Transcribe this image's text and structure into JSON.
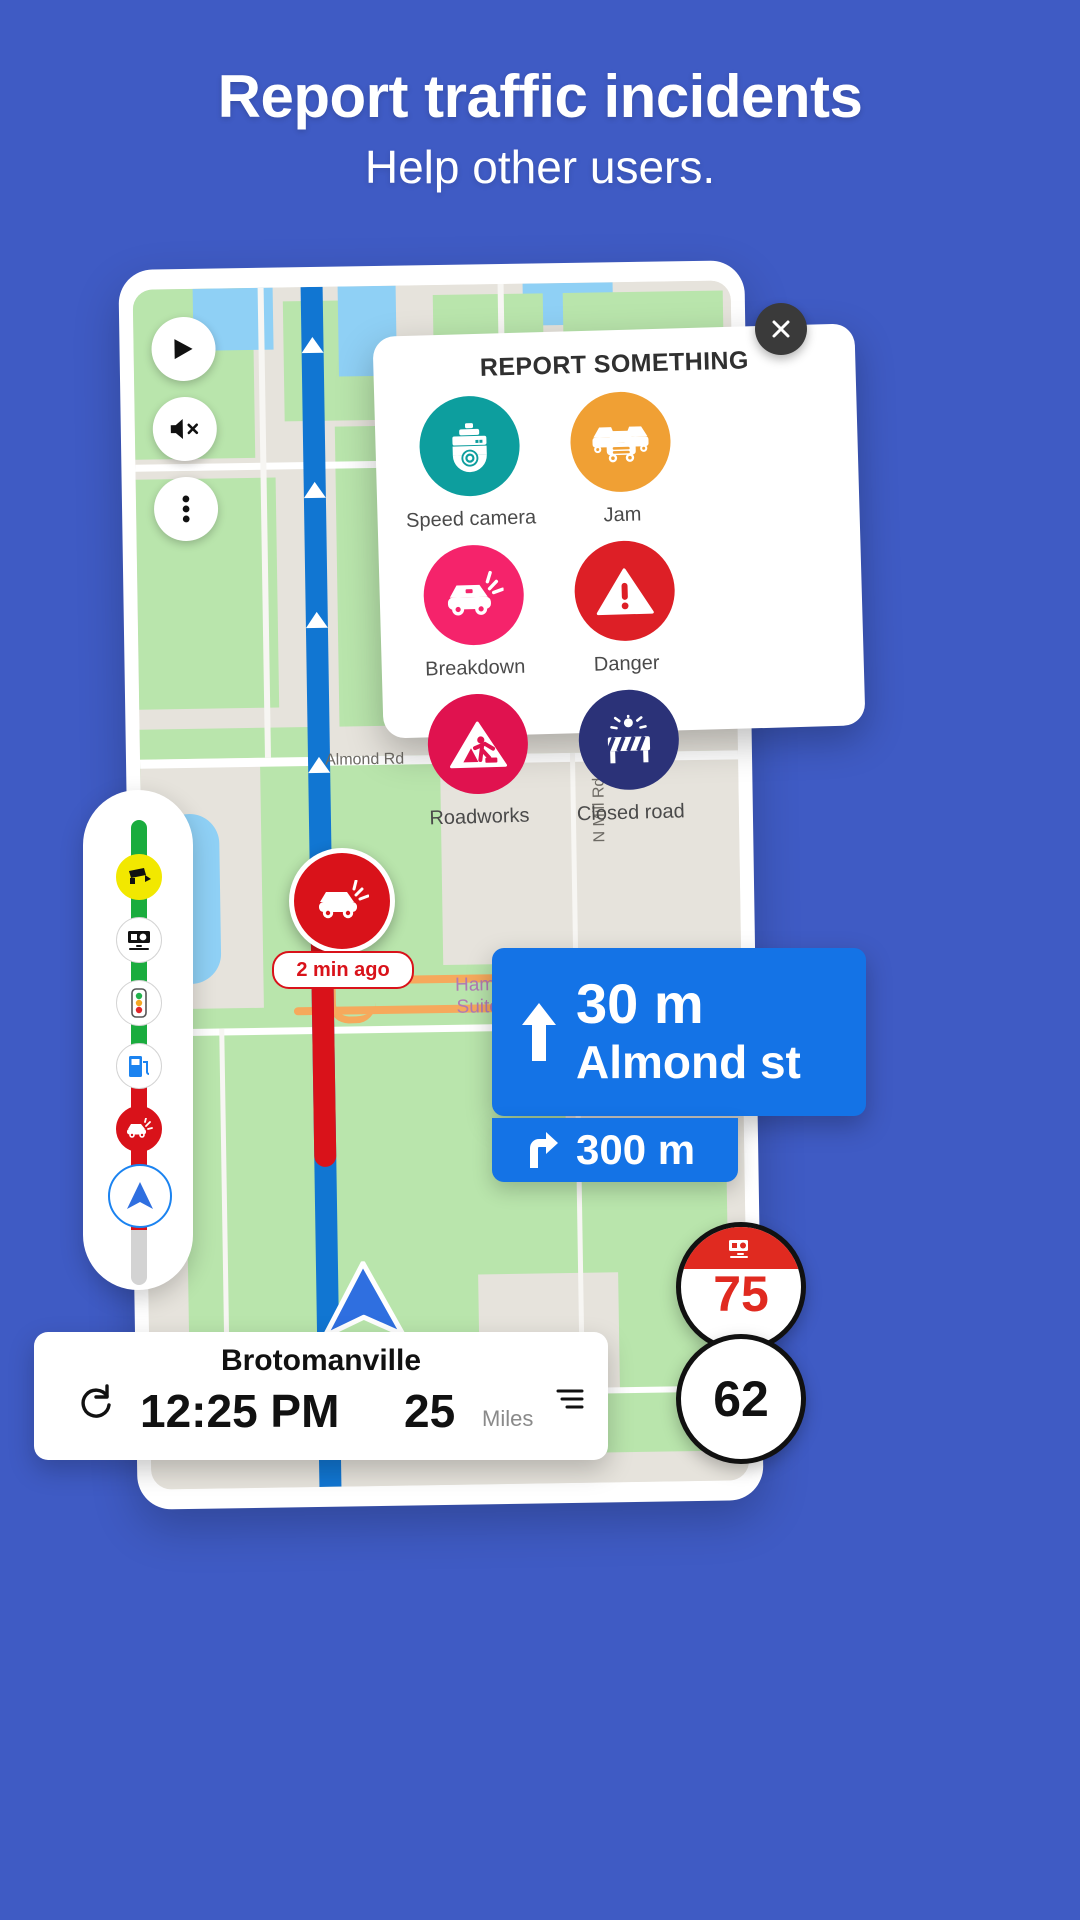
{
  "hero": {
    "title": "Report traffic incidents",
    "subtitle": "Help other users.",
    "background_color": "#3f5bc4"
  },
  "report_dialog": {
    "title": "REPORT SOMETHING",
    "close_icon": "close-icon",
    "items": [
      {
        "label": "Speed camera",
        "icon": "speed-camera-icon",
        "color": "#0d9e9e"
      },
      {
        "label": "Jam",
        "icon": "traffic-jam-icon",
        "color": "#f0a034"
      },
      {
        "label": "Breakdown",
        "icon": "car-breakdown-icon",
        "color": "#f5236b"
      },
      {
        "label": "Danger",
        "icon": "warning-triangle-icon",
        "color": "#dd1f26"
      },
      {
        "label": "Roadworks",
        "icon": "roadworks-icon",
        "color": "#e0124f"
      },
      {
        "label": "Closed road",
        "icon": "closed-road-icon",
        "color": "#2b3278"
      }
    ]
  },
  "map_controls": [
    {
      "name": "compass-button",
      "icon": "navigation-cursor-icon"
    },
    {
      "name": "mute-button",
      "icon": "speaker-muted-icon"
    },
    {
      "name": "more-button",
      "icon": "more-vertical-icon"
    }
  ],
  "map_labels": {
    "almond_rd": "Almond Rd",
    "n_mill_rd": "N Mill Rd",
    "poi_line1": "Hampton",
    "poi_line2": "Suites Vi"
  },
  "route_strip": {
    "stops": [
      {
        "icon": "speed-camera-icon",
        "style": "yellow"
      },
      {
        "icon": "camera-icon",
        "style": "white"
      },
      {
        "icon": "traffic-light-icon",
        "style": "white"
      },
      {
        "icon": "fuel-pump-icon",
        "style": "white"
      },
      {
        "icon": "car-breakdown-icon",
        "style": "red"
      }
    ],
    "position_icon": "navigation-arrow-icon",
    "segment_ok_color": "#1aac3e",
    "segment_jam_color": "#d9121a"
  },
  "incident_marker": {
    "icon": "car-breakdown-icon",
    "time_label": "2 min ago",
    "color": "#d9121a"
  },
  "navigation": {
    "primary_distance": "30 m",
    "primary_street": "Almond st",
    "primary_maneuver_icon": "arrow-straight-icon",
    "secondary_distance": "300 m",
    "secondary_maneuver_icon": "arrow-right-turn-icon",
    "banner_color": "#1473e6"
  },
  "speed": {
    "limit_value": "75",
    "limit_icon": "speed-camera-icon",
    "current_value": "62"
  },
  "bottom_bar": {
    "city": "Brotomanville",
    "eta_time": "12:25 PM",
    "distance_value": "25",
    "distance_unit": "Miles",
    "refresh_icon": "refresh-icon",
    "menu_icon": "menu-lines-icon"
  }
}
